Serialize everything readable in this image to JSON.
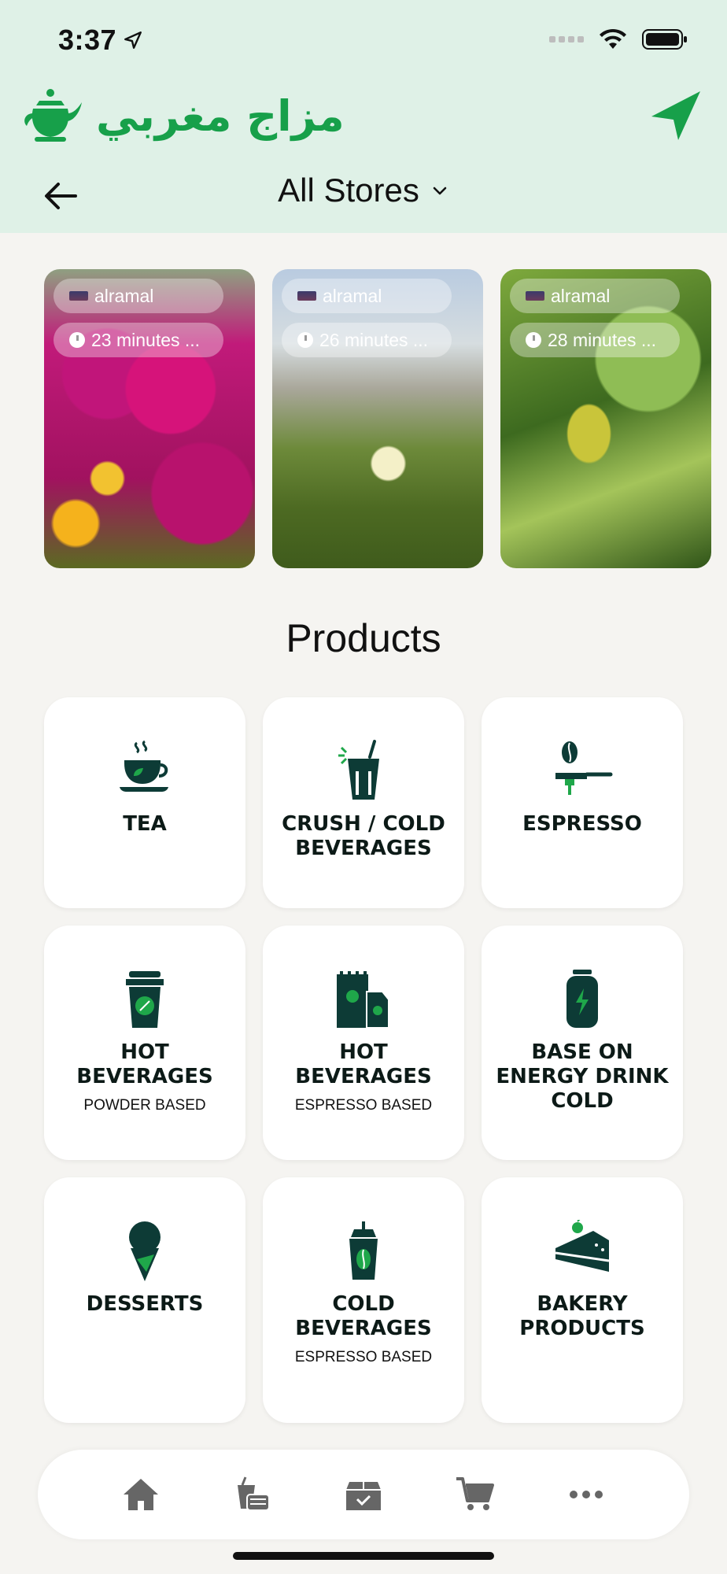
{
  "status": {
    "time": "3:37"
  },
  "header": {
    "brand_text": "مزاج مغربي",
    "store_selector": "All Stores"
  },
  "stories": [
    {
      "store": "alramal",
      "time": "23 minutes ..."
    },
    {
      "store": "alramal",
      "time": "26 minutes ..."
    },
    {
      "store": "alramal",
      "time": "28 minutes ..."
    }
  ],
  "products": {
    "title": "Products",
    "items": [
      {
        "title": "TEA",
        "sub": "",
        "icon": "teacup-icon"
      },
      {
        "title": "CRUSH / COLD BEVERAGES",
        "sub": "",
        "icon": "cold-drink-icon"
      },
      {
        "title": "ESPRESSO",
        "sub": "",
        "icon": "espresso-machine-icon"
      },
      {
        "title": "HOT BEVERAGES",
        "sub": "POWDER BASED",
        "icon": "coffee-cup-icon"
      },
      {
        "title": "HOT BEVERAGES",
        "sub": "ESPRESSO BASED",
        "icon": "coffee-bags-icon"
      },
      {
        "title": "BASE ON ENERGY DRINK COLD",
        "sub": "",
        "icon": "energy-can-icon"
      },
      {
        "title": "DESSERTS",
        "sub": "",
        "icon": "ice-cream-icon"
      },
      {
        "title": "COLD BEVERAGES",
        "sub": "ESPRESSO BASED",
        "icon": "iced-coffee-icon"
      },
      {
        "title": "BAKERY PRODUCTS",
        "sub": "",
        "icon": "cake-slice-icon"
      }
    ]
  },
  "nav": [
    "home-icon",
    "orders-icon",
    "box-icon",
    "cart-icon",
    "more-icon"
  ],
  "colors": {
    "header_bg": "#dff1e7",
    "brand": "#17a04a",
    "icon_dark": "#0d3b36"
  }
}
